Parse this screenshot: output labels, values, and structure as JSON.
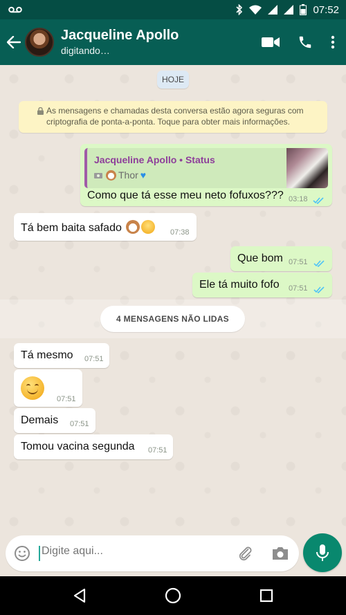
{
  "status_bar": {
    "time": "07:52"
  },
  "header": {
    "contact_name": "Jacqueline Apollo",
    "contact_status": "digitando…"
  },
  "chat": {
    "date_chip": "HOJE",
    "encryption_notice": "As mensagens e chamadas desta conversa estão agora seguras com criptografia de ponta-a-ponta. Toque para obter mais informações.",
    "reply": {
      "quoted_name": "Jacqueline Apollo • Status",
      "quoted_text": "Thor",
      "text": "Como que tá esse meu neto fofuxos???",
      "time": "03:18"
    },
    "messages_before": [
      {
        "text": "Tá bem baita safado",
        "time": "07:38"
      },
      {
        "text": "Que bom",
        "time": "07:51"
      },
      {
        "text": "Ele tá muito fofo",
        "time": "07:51"
      }
    ],
    "unread_label": "4 MENSAGENS NÃO LIDAS",
    "messages_after": [
      {
        "text": "Tá mesmo",
        "time": "07:51"
      },
      {
        "text": "",
        "time": "07:51"
      },
      {
        "text": "Demais",
        "time": "07:51"
      },
      {
        "text": "Tomou vacina segunda",
        "time": "07:51"
      }
    ]
  },
  "composer": {
    "placeholder": "Digite aqui..."
  },
  "colors": {
    "header": "#075e54",
    "outgoing": "#dcf8c6",
    "incoming": "#ffffff",
    "accent": "#09886e",
    "read_ticks": "#4fc3f7"
  }
}
